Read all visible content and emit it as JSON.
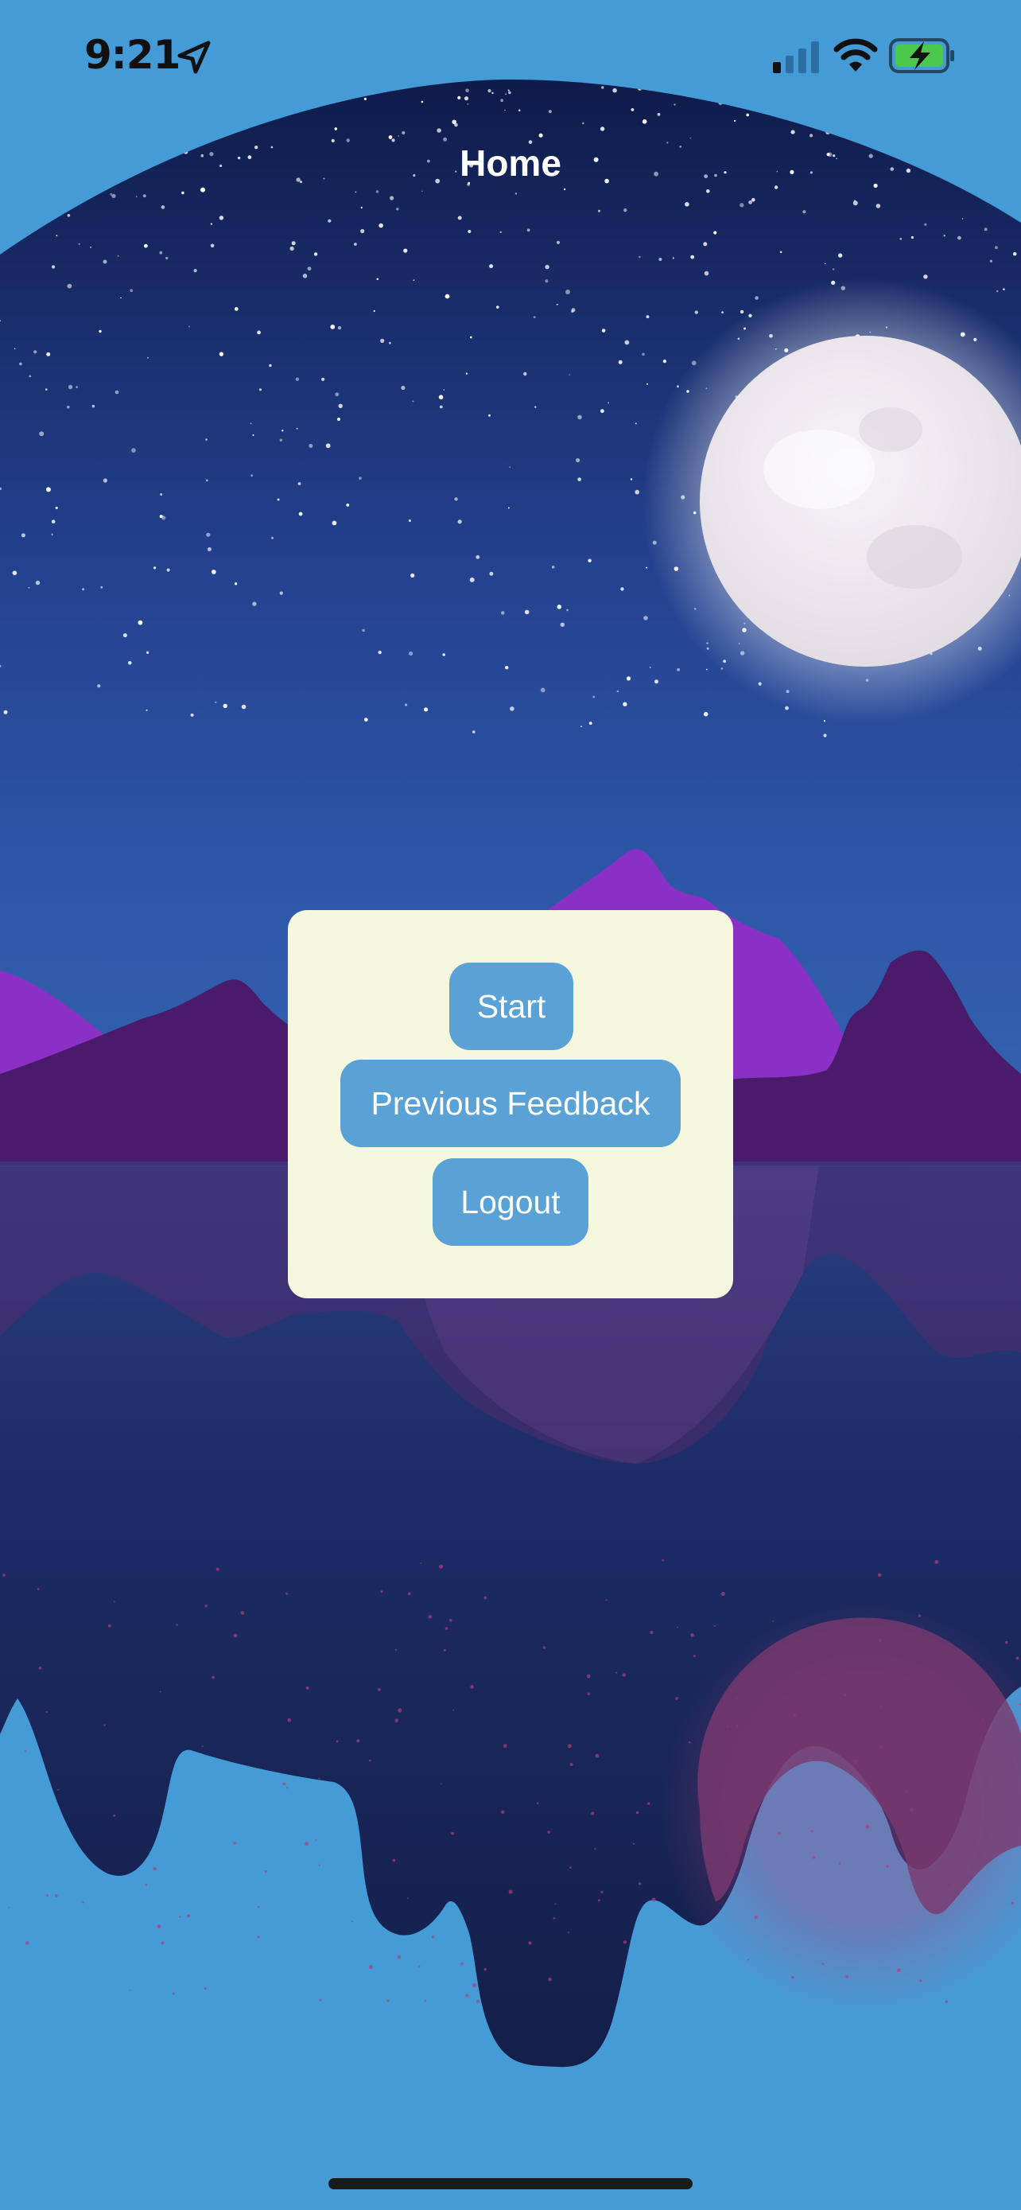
{
  "status_bar": {
    "time": "9:21",
    "icons": [
      "location-arrow-icon",
      "cellular-signal-icon",
      "wifi-icon",
      "battery-charging-icon"
    ]
  },
  "nav": {
    "title": "Home"
  },
  "menu": {
    "start_label": "Start",
    "feedback_label": "Previous Feedback",
    "logout_label": "Logout"
  },
  "colors": {
    "page_background": "#459bd6",
    "card_background": "#f4f6dd",
    "button_background": "#5aa1d6",
    "button_text": "#ffffff",
    "night_sky": "#142256",
    "mountain_purple": "#8a2fc4",
    "mountain_dark": "#4a1a6b",
    "moon": "#f2eff3"
  }
}
